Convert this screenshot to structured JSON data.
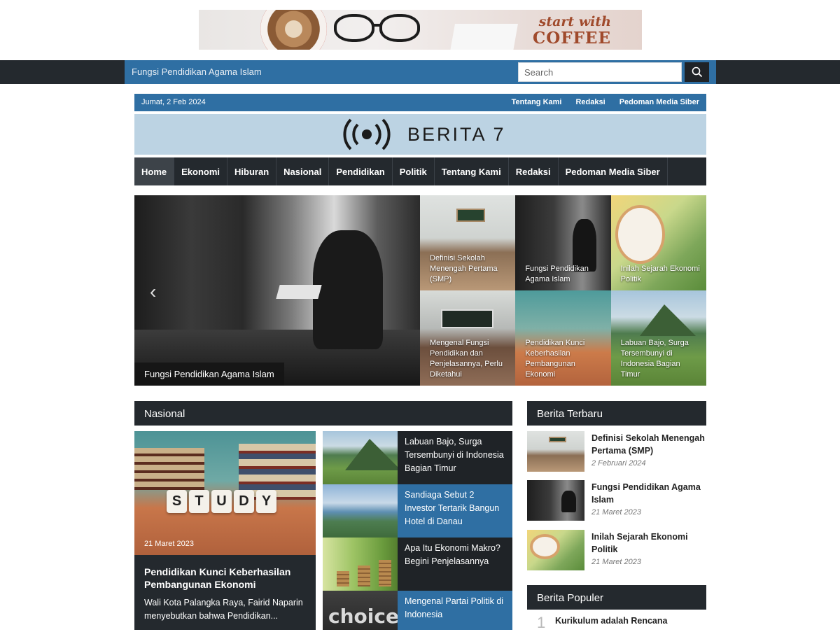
{
  "ad": {
    "line1": "start with",
    "line2": "COFFEE"
  },
  "topbar": {
    "ticker": "Fungsi Pendidikan Agama Islam",
    "search_placeholder": "Search"
  },
  "infobar": {
    "date": "Jumat, 2 Feb 2024",
    "links": [
      "Tentang Kami",
      "Redaksi",
      "Pedoman Media Siber"
    ]
  },
  "logo": {
    "text": "BERITA 7"
  },
  "nav": [
    "Home",
    "Ekonomi",
    "Hiburan",
    "Nasional",
    "Pendidikan",
    "Politik",
    "Tentang Kami",
    "Redaksi",
    "Pedoman Media Siber"
  ],
  "slider": {
    "caption": "Fungsi Pendidikan Agama Islam"
  },
  "grid": [
    "Definisi Sekolah Menengah Pertama (SMP)",
    "Fungsi Pendidikan Agama Islam",
    "Inilah Sejarah Ekonomi Politik",
    "Mengenal Fungsi Pendidikan dan Penjelasannya, Perlu Diketahui",
    "Pendidikan Kunci Keberhasilan Pembangunan Ekonomi",
    "Labuan Bajo, Surga Tersembunyi di Indonesia Bagian Timur"
  ],
  "nasional": {
    "heading": "Nasional",
    "feature": {
      "date": "21 Maret 2023",
      "title": "Pendidikan Kunci Keberhasilan Pembangunan Ekonomi",
      "excerpt": "Wali Kota Palangka Raya, Fairid Naparin menyebutkan bahwa Pendidikan...",
      "cube_letters": [
        "S",
        "T",
        "U",
        "D",
        "Y"
      ]
    },
    "list": [
      "Labuan Bajo, Surga Tersembunyi di Indonesia Bagian Timur",
      "Sandiaga Sebut 2 Investor Tertarik Bangun Hotel di Danau",
      "Apa Itu Ekonomi Makro? Begini Penjelasannya",
      "Mengenal Partai Politik di Indonesia"
    ],
    "choice_word": "choice"
  },
  "terbaru": {
    "heading": "Berita Terbaru",
    "items": [
      {
        "title": "Definisi Sekolah Menengah Pertama (SMP)",
        "date": "2 Februari 2024"
      },
      {
        "title": "Fungsi Pendidikan Agama Islam",
        "date": "21 Maret 2023"
      },
      {
        "title": "Inilah Sejarah Ekonomi Politik",
        "date": "21 Maret 2023"
      }
    ]
  },
  "populer": {
    "heading": "Berita Populer",
    "items": [
      {
        "rank": "1",
        "title": "Kurikulum adalah Rencana"
      }
    ]
  }
}
